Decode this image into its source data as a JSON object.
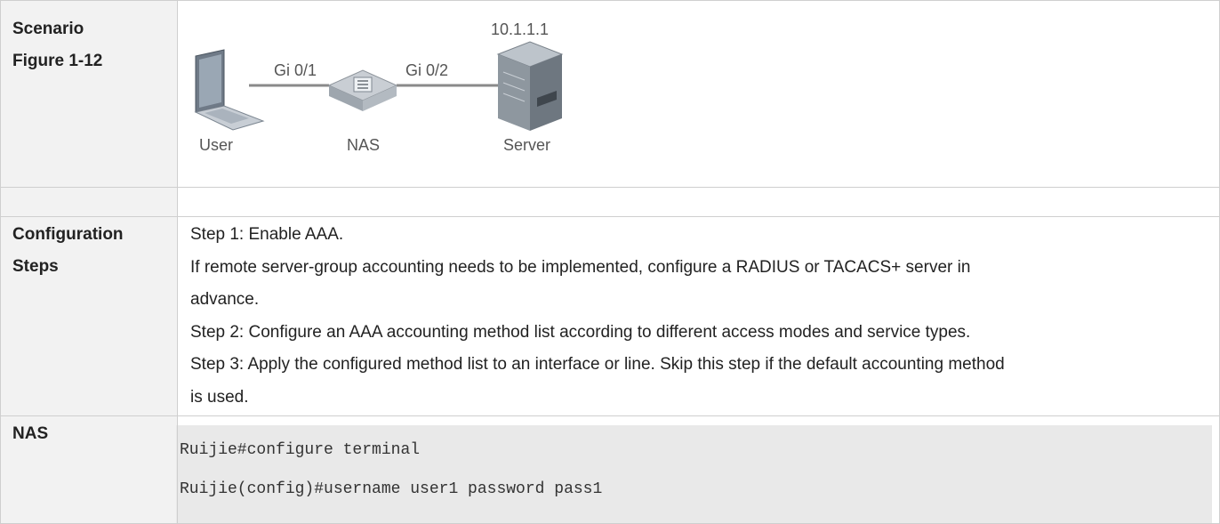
{
  "rows": {
    "scenario": {
      "label_line1": "Scenario",
      "label_line2": "Figure 1-12",
      "figure": {
        "ip": "10.1.1.1",
        "left_port": "Gi 0/1",
        "right_port": "Gi 0/2",
        "user_label": "User",
        "nas_label": "NAS",
        "server_label": "Server"
      }
    },
    "steps": {
      "label_line1": "Configuration",
      "label_line2": "Steps",
      "lines": [
        "Step 1: Enable AAA.",
        "If remote server-group accounting needs to be implemented, configure a RADIUS or TACACS+ server in",
        "advance.",
        "Step 2: Configure an AAA accounting method list according to different access modes and service types.",
        "Step 3: Apply the configured method list to an interface or line. Skip this step if the default accounting method",
        "is used."
      ]
    },
    "nas": {
      "label": "NAS",
      "code": [
        "Ruijie#configure terminal",
        "Ruijie(config)#username user1 password pass1"
      ]
    }
  },
  "colors": {
    "label_bg": "#f2f2f2",
    "border": "#cfcfcf",
    "code_bg": "#e9e9e9"
  }
}
